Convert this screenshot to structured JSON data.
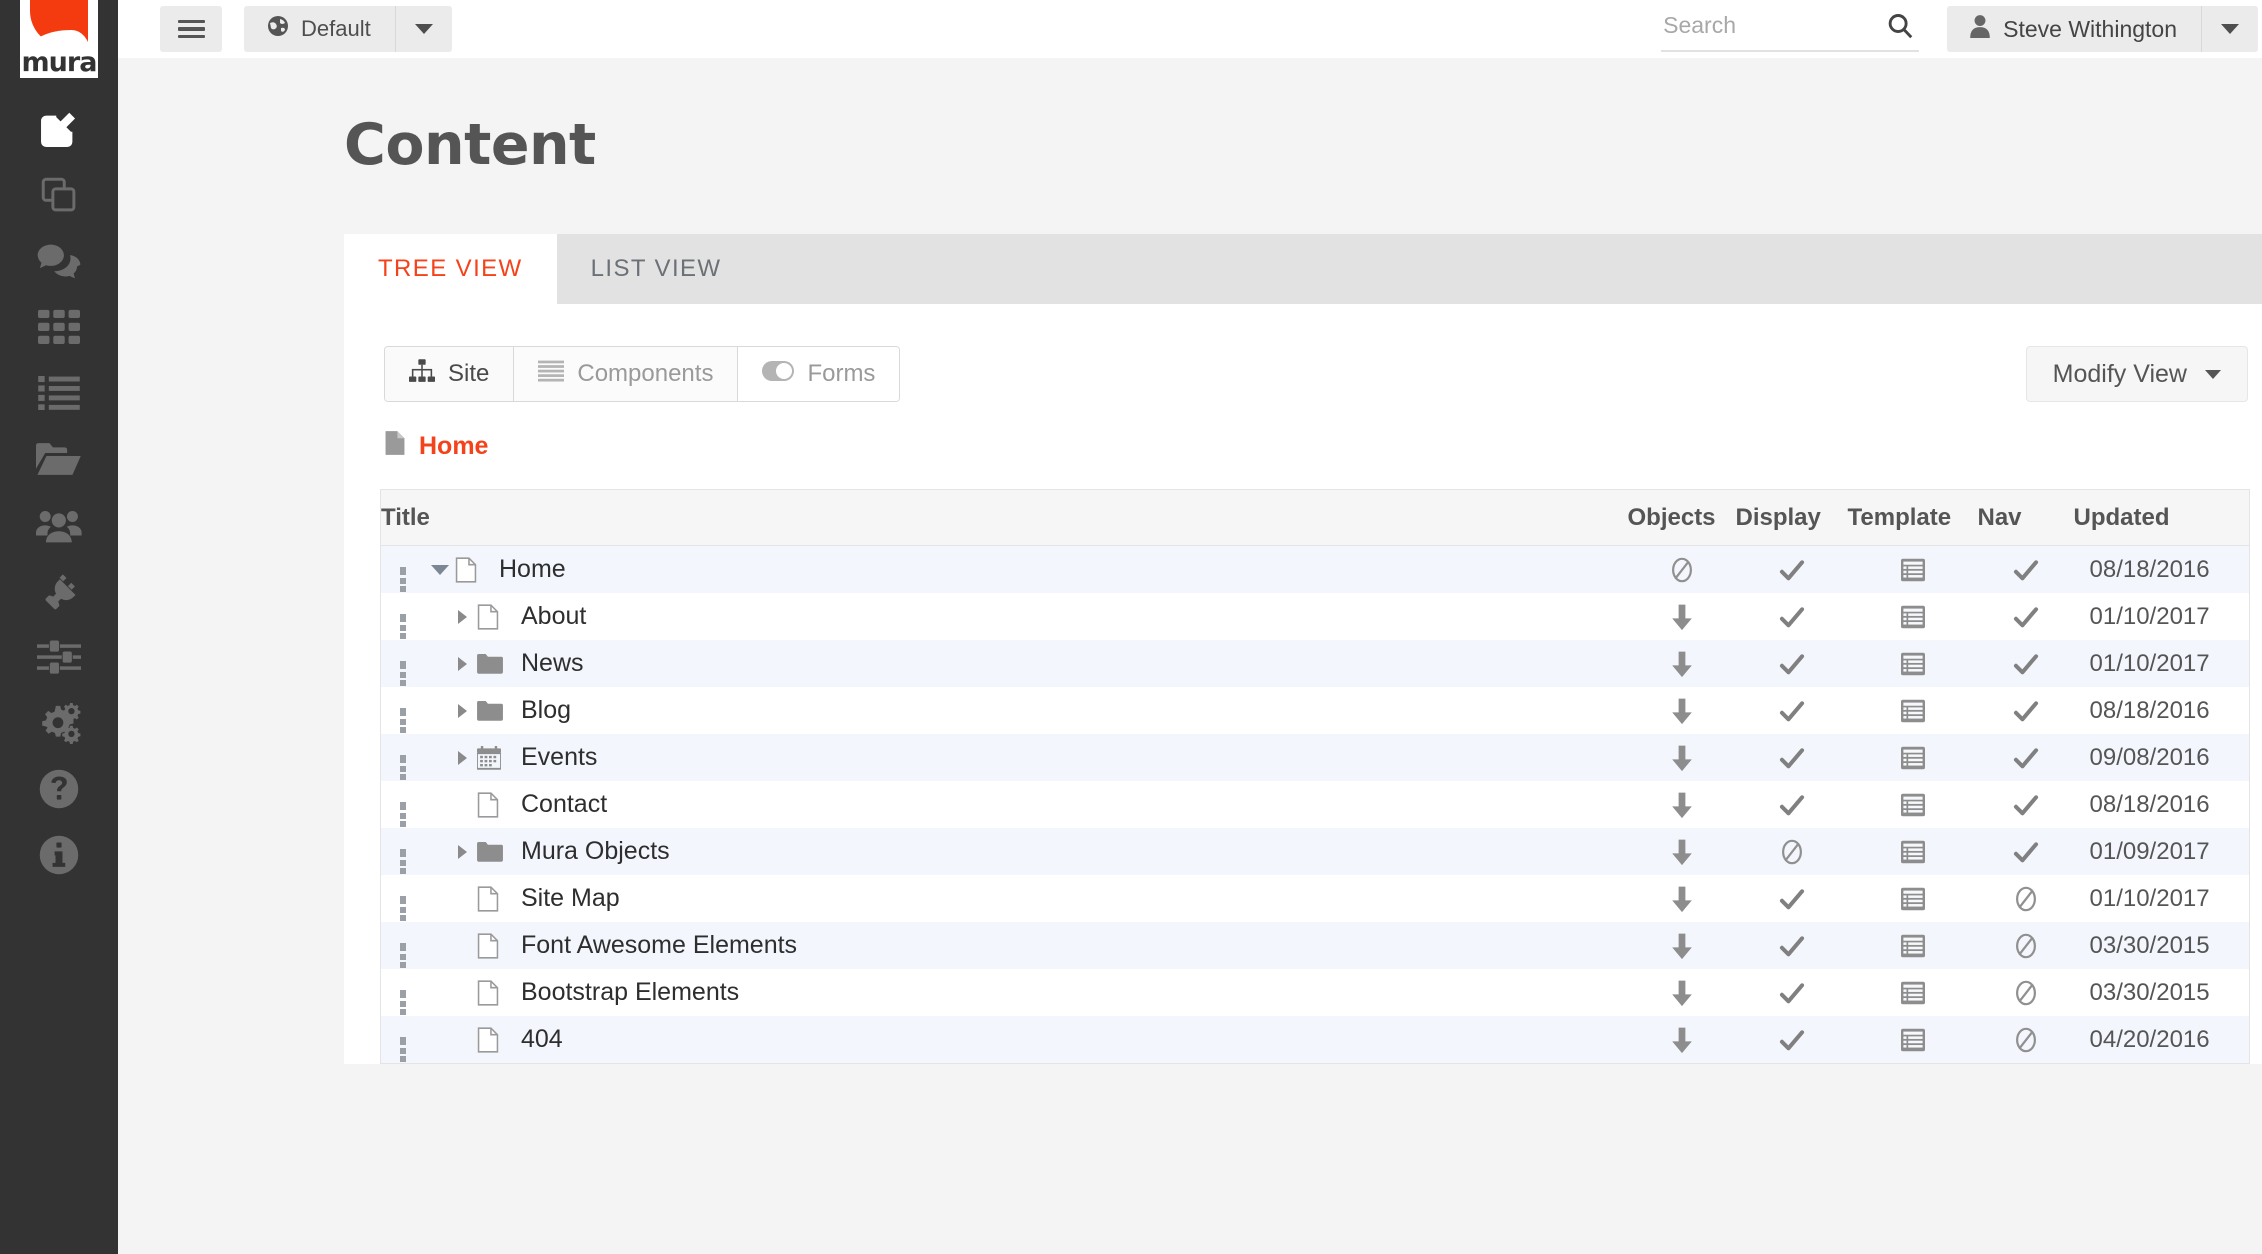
{
  "brand": {
    "logo_text": "mura",
    "accent": "#f4421b",
    "flag_color": "#f43b10"
  },
  "sidebar": {
    "items": [
      {
        "icon": "edit-pencil-icon",
        "name": "sidebar-item-edit",
        "active": true
      },
      {
        "icon": "copy-pages-icon",
        "name": "sidebar-item-content",
        "active": false
      },
      {
        "icon": "comments-icon",
        "name": "sidebar-item-comments",
        "active": false
      },
      {
        "icon": "grid-apps-icon",
        "name": "sidebar-item-apps",
        "active": false
      },
      {
        "icon": "list-icon",
        "name": "sidebar-item-lists",
        "active": false
      },
      {
        "icon": "folder-open-icon",
        "name": "sidebar-item-files",
        "active": false
      },
      {
        "icon": "users-icon",
        "name": "sidebar-item-users",
        "active": false
      },
      {
        "icon": "plug-icon",
        "name": "sidebar-item-plugins",
        "active": false
      },
      {
        "icon": "sliders-icon",
        "name": "sidebar-item-settings",
        "active": false
      },
      {
        "icon": "gears-icon",
        "name": "sidebar-item-config",
        "active": false
      },
      {
        "icon": "question-circle-icon",
        "name": "sidebar-item-help",
        "active": false
      },
      {
        "icon": "info-circle-icon",
        "name": "sidebar-item-about",
        "active": false
      }
    ]
  },
  "topbar": {
    "menu_icon": "hamburger-icon",
    "site": {
      "label": "Default",
      "icon": "globe-icon",
      "caret": "chevron-down-icon"
    },
    "search": {
      "value": "",
      "placeholder": "Search",
      "icon": "search-icon"
    },
    "user": {
      "label": "Steve Withington",
      "icon": "user-icon",
      "caret": "chevron-down-icon"
    }
  },
  "page": {
    "title": "Content",
    "tabs": [
      {
        "label": "TREE VIEW",
        "active": true
      },
      {
        "label": "LIST VIEW",
        "active": false
      }
    ],
    "toolbar": {
      "groups": [
        {
          "label": "Site",
          "icon": "sitemap-icon",
          "active": true
        },
        {
          "label": "Components",
          "icon": "bars-icon",
          "active": false
        },
        {
          "label": "Forms",
          "icon": "toggle-on-icon",
          "active": false
        }
      ],
      "modify_view": {
        "label": "Modify View",
        "caret": "chevron-down-icon"
      }
    },
    "breadcrumb": {
      "label": "Home",
      "icon": "file-icon"
    }
  },
  "table": {
    "columns": [
      "Title",
      "Objects",
      "Display",
      "Template",
      "Nav",
      "Updated"
    ],
    "rows": [
      {
        "title": "Home",
        "icon": "file-icon",
        "depth": 0,
        "twisty": "down",
        "objects": "ban",
        "display": "check",
        "template": "template-icon",
        "nav": "check",
        "updated": "08/18/2016"
      },
      {
        "title": "About",
        "icon": "file-icon",
        "depth": 1,
        "twisty": "right",
        "objects": "arrow",
        "display": "check",
        "template": "template-icon",
        "nav": "check",
        "updated": "01/10/2017"
      },
      {
        "title": "News",
        "icon": "folder-icon",
        "depth": 1,
        "twisty": "right",
        "objects": "arrow",
        "display": "check",
        "template": "template-icon",
        "nav": "check",
        "updated": "01/10/2017"
      },
      {
        "title": "Blog",
        "icon": "folder-icon",
        "depth": 1,
        "twisty": "right",
        "objects": "arrow",
        "display": "check",
        "template": "template-icon",
        "nav": "check",
        "updated": "08/18/2016"
      },
      {
        "title": "Events",
        "icon": "calendar-icon",
        "depth": 1,
        "twisty": "right",
        "objects": "arrow",
        "display": "check",
        "template": "template-icon",
        "nav": "check",
        "updated": "09/08/2016"
      },
      {
        "title": "Contact",
        "icon": "file-icon",
        "depth": 1,
        "twisty": "none",
        "objects": "arrow",
        "display": "check",
        "template": "template-icon",
        "nav": "check",
        "updated": "08/18/2016"
      },
      {
        "title": "Mura Objects",
        "icon": "folder-icon",
        "depth": 1,
        "twisty": "right",
        "objects": "arrow",
        "display": "ban",
        "template": "template-icon",
        "nav": "check",
        "updated": "01/09/2017"
      },
      {
        "title": "Site Map",
        "icon": "file-icon",
        "depth": 1,
        "twisty": "none",
        "objects": "arrow",
        "display": "check",
        "template": "template-icon",
        "nav": "ban",
        "updated": "01/10/2017"
      },
      {
        "title": "Font Awesome Elements",
        "icon": "file-icon",
        "depth": 1,
        "twisty": "none",
        "objects": "arrow",
        "display": "check",
        "template": "template-icon",
        "nav": "ban",
        "updated": "03/30/2015"
      },
      {
        "title": "Bootstrap Elements",
        "icon": "file-icon",
        "depth": 1,
        "twisty": "none",
        "objects": "arrow",
        "display": "check",
        "template": "template-icon",
        "nav": "ban",
        "updated": "03/30/2015"
      },
      {
        "title": "404",
        "icon": "file-icon",
        "depth": 1,
        "twisty": "none",
        "objects": "arrow",
        "display": "check",
        "template": "template-icon",
        "nav": "ban",
        "updated": "04/20/2016"
      }
    ]
  }
}
